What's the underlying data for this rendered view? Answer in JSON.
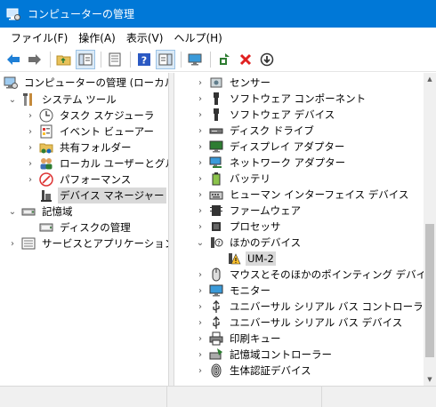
{
  "window": {
    "title": "コンピューターの管理"
  },
  "menu": [
    "ファイル(F)",
    "操作(A)",
    "表示(V)",
    "ヘルプ(H)"
  ],
  "toolbar": {
    "buttons": [
      "back-arrow-icon",
      "forward-arrow-icon",
      "up-folder-icon",
      "show-hide-tree-icon",
      "properties-icon",
      "help-icon",
      "action-pane-icon",
      "monitor-icon",
      "update-driver-icon",
      "uninstall-icon",
      "disable-icon"
    ]
  },
  "left_tree": {
    "root": "コンピューターの管理 (ローカル)",
    "system_tools": "システム ツール",
    "task_scheduler": "タスク スケジューラ",
    "event_viewer": "イベント ビューアー",
    "shared_folders": "共有フォルダー",
    "local_users": "ローカル ユーザーとグループ",
    "performance": "パフォーマンス",
    "device_manager": "デバイス マネージャー",
    "storage": "記憶域",
    "disk_management": "ディスクの管理",
    "services_apps": "サービスとアプリケーション"
  },
  "right_tree": {
    "items": [
      {
        "label": "センサー",
        "icon": "sensor-icon"
      },
      {
        "label": "ソフトウェア コンポーネント",
        "icon": "software-component-icon"
      },
      {
        "label": "ソフトウェア デバイス",
        "icon": "software-device-icon"
      },
      {
        "label": "ディスク ドライブ",
        "icon": "disk-drive-icon"
      },
      {
        "label": "ディスプレイ アダプター",
        "icon": "display-adapter-icon"
      },
      {
        "label": "ネットワーク アダプター",
        "icon": "network-adapter-icon"
      },
      {
        "label": "バッテリ",
        "icon": "battery-icon"
      },
      {
        "label": "ヒューマン インターフェイス デバイス",
        "icon": "hid-icon"
      },
      {
        "label": "ファームウェア",
        "icon": "firmware-icon"
      },
      {
        "label": "プロセッサ",
        "icon": "processor-icon"
      },
      {
        "label": "ほかのデバイス",
        "icon": "other-devices-icon"
      },
      {
        "label": "UM-2",
        "icon": "warning-device-icon"
      },
      {
        "label": "マウスとそのほかのポインティング デバイス",
        "icon": "mouse-icon"
      },
      {
        "label": "モニター",
        "icon": "monitor-icon"
      },
      {
        "label": "ユニバーサル シリアル バス コントローラー",
        "icon": "usb-controller-icon"
      },
      {
        "label": "ユニバーサル シリアル バス デバイス",
        "icon": "usb-device-icon"
      },
      {
        "label": "印刷キュー",
        "icon": "print-queue-icon"
      },
      {
        "label": "記憶域コントローラー",
        "icon": "storage-controller-icon"
      },
      {
        "label": "生体認証デバイス",
        "icon": "biometric-icon"
      }
    ]
  },
  "colors": {
    "titlebar": "#0078d7",
    "selection": "#d9d9d9",
    "accent": "#0078d7"
  }
}
